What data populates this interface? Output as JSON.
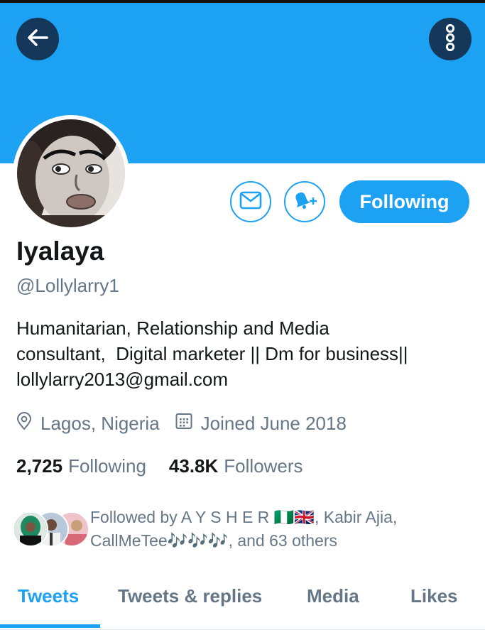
{
  "colors": {
    "accent": "#1da1f2",
    "banner": "#1da1f2",
    "overlay_button": "#14375a",
    "secondary_text": "#657786",
    "primary_text": "#14171a"
  },
  "header": {
    "back_icon": "arrow-left-icon",
    "more_icon": "vertical-dots-icon"
  },
  "actions": {
    "message_icon": "envelope-icon",
    "notify_icon": "bell-plus-icon",
    "follow_label": "Following"
  },
  "profile": {
    "name": "Iyalaya",
    "handle": "@Lollylarry1",
    "bio_lines": [
      "Humanitarian, Relationship and Media",
      "consultant,  Digital marketer || Dm for business||",
      "lollylarry2013@gmail.com"
    ],
    "location": "Lagos, Nigeria",
    "joined": "Joined June 2018",
    "location_icon": "location-pin-icon",
    "joined_icon": "calendar-icon"
  },
  "stats": {
    "following_count": "2,725",
    "following_label": "Following",
    "followers_count": "43.8K",
    "followers_label": "Followers"
  },
  "followed_by": {
    "line1": "Followed by A Y S H E R 🇳🇬🇬🇧, Kabir Ajia,",
    "line2": "CallMeTee🎶🎶🎶, and 63 others"
  },
  "tabs": [
    {
      "label": "Tweets",
      "active": true
    },
    {
      "label": "Tweets & replies",
      "active": false
    },
    {
      "label": "Media",
      "active": false
    },
    {
      "label": "Likes",
      "active": false
    }
  ]
}
